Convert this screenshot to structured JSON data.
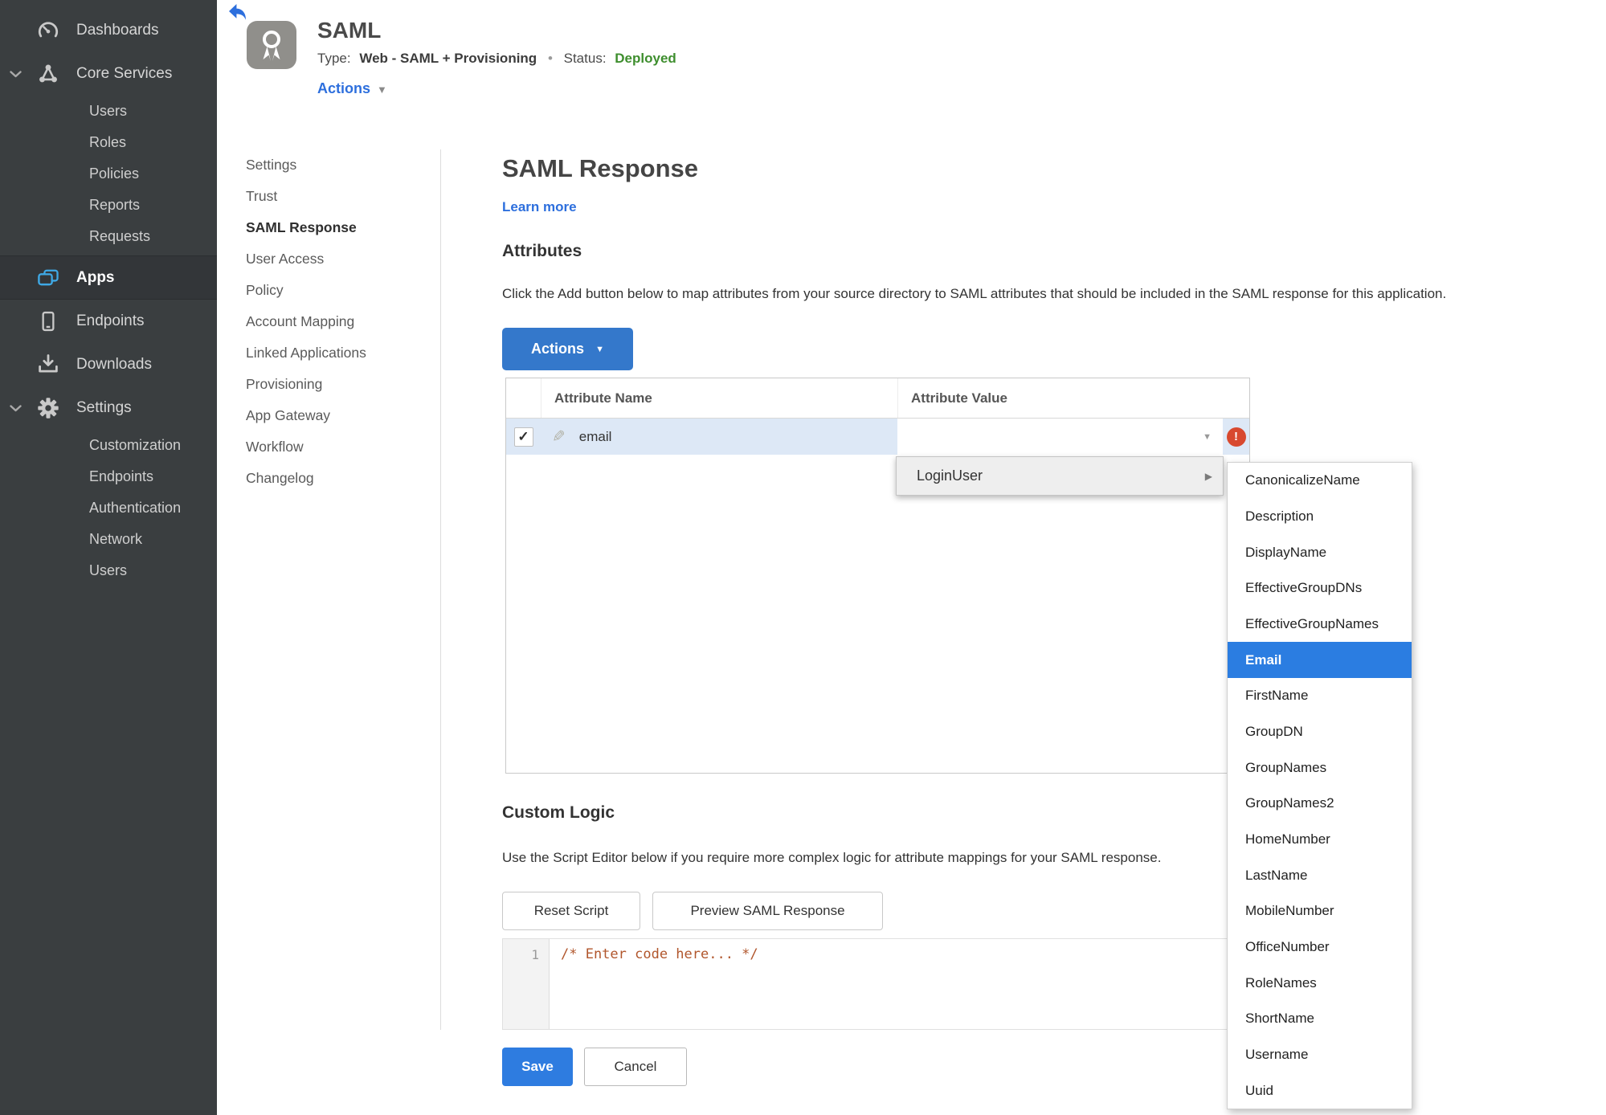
{
  "colors": {
    "accent_blue": "#2d6fdd",
    "button_blue": "#3478cb",
    "status_green": "#3e8e2e",
    "error_red": "#d8492f",
    "selection_blue": "#2b7de1",
    "row_highlight": "#dde8f6",
    "sidebar_bg": "#3a3e40"
  },
  "icons": {
    "back": "back-arrow",
    "app_badge": "award-ribbon",
    "dashboards": "gauge",
    "core_services": "node-triangle",
    "apps": "stacked-windows",
    "endpoints": "mobile-device",
    "downloads": "download-tray",
    "settings": "gear",
    "chevron": "chevron-down",
    "edit_glyph": "✎",
    "check_glyph": "✓",
    "caret_glyph": "▼",
    "submenu_arrow_glyph": "▶",
    "error_glyph": "!"
  },
  "sidebar": {
    "dashboards": "Dashboards",
    "core_services": "Core Services",
    "core_children": [
      "Users",
      "Roles",
      "Policies",
      "Reports",
      "Requests"
    ],
    "apps": "Apps",
    "endpoints": "Endpoints",
    "downloads": "Downloads",
    "settings": "Settings",
    "settings_children": [
      "Customization",
      "Endpoints",
      "Authentication",
      "Network",
      "Users"
    ]
  },
  "header": {
    "title": "SAML",
    "type_label": "Type:",
    "type_value": "Web - SAML + Provisioning",
    "bullet": "•",
    "status_label": "Status:",
    "status_value": "Deployed",
    "actions_label": "Actions"
  },
  "page_nav": {
    "items": [
      "Settings",
      "Trust",
      "SAML Response",
      "User Access",
      "Policy",
      "Account Mapping",
      "Linked Applications",
      "Provisioning",
      "App Gateway",
      "Workflow",
      "Changelog"
    ],
    "active": "SAML Response"
  },
  "main": {
    "title": "SAML Response",
    "learn_more": "Learn more",
    "attributes": {
      "heading": "Attributes",
      "description": "Click the Add button below to map attributes from your source directory to SAML attributes that should be included in the SAML response for this application.",
      "actions_button": "Actions",
      "table": {
        "columns": [
          "",
          "Attribute Name",
          "Attribute Value"
        ],
        "row": {
          "name": "email",
          "value": "",
          "checked": "true"
        }
      }
    },
    "value_menu": {
      "group_label": "LoginUser"
    },
    "submenu": {
      "items": [
        "CanonicalizeName",
        "Description",
        "DisplayName",
        "EffectiveGroupDNs",
        "EffectiveGroupNames",
        "Email",
        "FirstName",
        "GroupDN",
        "GroupNames",
        "GroupNames2",
        "HomeNumber",
        "LastName",
        "MobileNumber",
        "OfficeNumber",
        "RoleNames",
        "ShortName",
        "Username",
        "Uuid"
      ],
      "selected": "Email"
    },
    "custom_logic": {
      "heading": "Custom Logic",
      "description": "Use the Script Editor below if you require more complex logic for attribute mappings for your SAML response.",
      "reset_button": "Reset Script",
      "preview_button": "Preview SAML Response"
    },
    "editor": {
      "line_number": "1",
      "code": "/* Enter code here... */"
    },
    "footer": {
      "save": "Save",
      "cancel": "Cancel"
    }
  }
}
